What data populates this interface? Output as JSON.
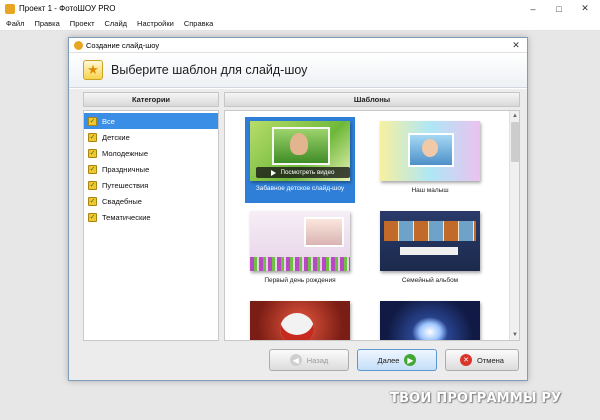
{
  "window": {
    "title": "Проект 1 - ФотоШОУ PRO",
    "controls": [
      "–",
      "□",
      "✕"
    ]
  },
  "menu": [
    "Файл",
    "Правка",
    "Проект",
    "Слайд",
    "Настройки",
    "Справка"
  ],
  "dialog": {
    "title": "Создание слайд-шоу",
    "close": "✕",
    "header": "Выберите шаблон для слайд-шоу",
    "categories_heading": "Категории",
    "templates_heading": "Шаблоны",
    "categories": [
      {
        "label": "Все",
        "selected": true
      },
      {
        "label": "Детские",
        "selected": false
      },
      {
        "label": "Молодежные",
        "selected": false
      },
      {
        "label": "Праздничные",
        "selected": false
      },
      {
        "label": "Путешествия",
        "selected": false
      },
      {
        "label": "Свадебные",
        "selected": false
      },
      {
        "label": "Тематические",
        "selected": false
      }
    ],
    "templates": [
      {
        "caption": "Забавное детское слайд-шоу",
        "selected": true,
        "play_label": "Посмотреть видео"
      },
      {
        "caption": "Наш малыш",
        "selected": false
      },
      {
        "caption": "Первый день рождения",
        "selected": false
      },
      {
        "caption": "Семейный альбом",
        "selected": false
      },
      {
        "caption": "",
        "selected": false
      },
      {
        "caption": "",
        "selected": false
      }
    ],
    "buttons": {
      "back": "Назад",
      "next": "Далее",
      "cancel": "Отмена"
    }
  },
  "colors": {
    "selection": "#3a8ee6",
    "next_icon": "#43a635",
    "cancel_icon": "#d9352a",
    "check_icon": "#f3c630"
  },
  "watermark": "ТВОИ ПРОГРАММЫ РУ"
}
